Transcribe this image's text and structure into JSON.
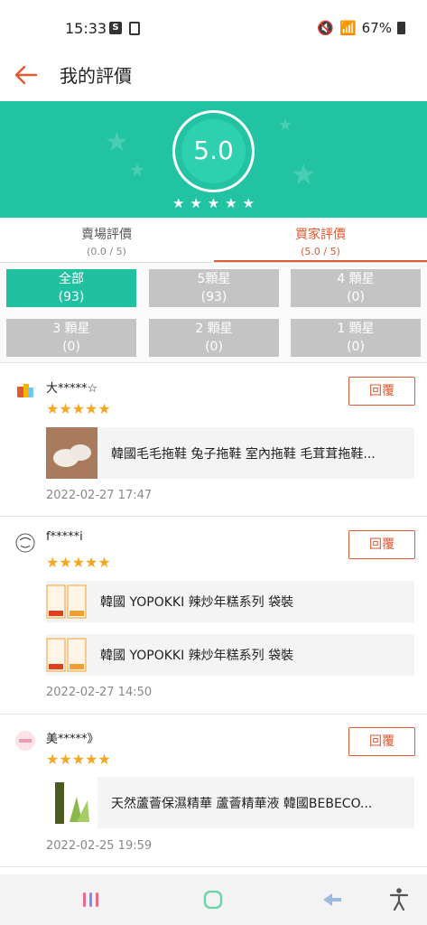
{
  "status": {
    "time": "15:33",
    "battery": "67%",
    "s_badge": "S"
  },
  "header": {
    "title": "我的評價"
  },
  "rating": {
    "score": "5.0",
    "stars": 5
  },
  "tabs": [
    {
      "label": "賣場評價",
      "sub": "(0.0 / 5)"
    },
    {
      "label": "買家評價",
      "sub": "(5.0 / 5)"
    }
  ],
  "filters": [
    {
      "label": "全部",
      "count": "(93)"
    },
    {
      "label": "5顆星",
      "count": "(93)"
    },
    {
      "label": "4 顆星",
      "count": "(0)"
    },
    {
      "label": "3 顆星",
      "count": "(0)"
    },
    {
      "label": "2 顆星",
      "count": "(0)"
    },
    {
      "label": "1 顆星",
      "count": "(0)"
    }
  ],
  "reviews": [
    {
      "user": "大*****☆",
      "reply": "回覆",
      "stars": "★★★★★",
      "products": [
        {
          "name": "韓國毛毛拖鞋 兔子拖鞋 室內拖鞋 毛茸茸拖鞋..."
        }
      ],
      "time": "2022-02-27 17:47"
    },
    {
      "user": "f*****i",
      "reply": "回覆",
      "stars": "★★★★★",
      "products": [
        {
          "name": "韓國 YOPOKKI 辣炒年糕系列 袋裝"
        },
        {
          "name": "韓國 YOPOKKI 辣炒年糕系列 袋裝"
        }
      ],
      "time": "2022-02-27 14:50"
    },
    {
      "user": "美*****》",
      "reply": "回覆",
      "stars": "★★★★★",
      "products": [
        {
          "name": "天然蘆薈保濕精華 蘆薈精華液 韓國BEBECO..."
        }
      ],
      "time": "2022-02-25 19:59"
    }
  ],
  "colors": {
    "accent": "#22c3a3",
    "orange": "#e05a33",
    "star": "#f5a623"
  }
}
